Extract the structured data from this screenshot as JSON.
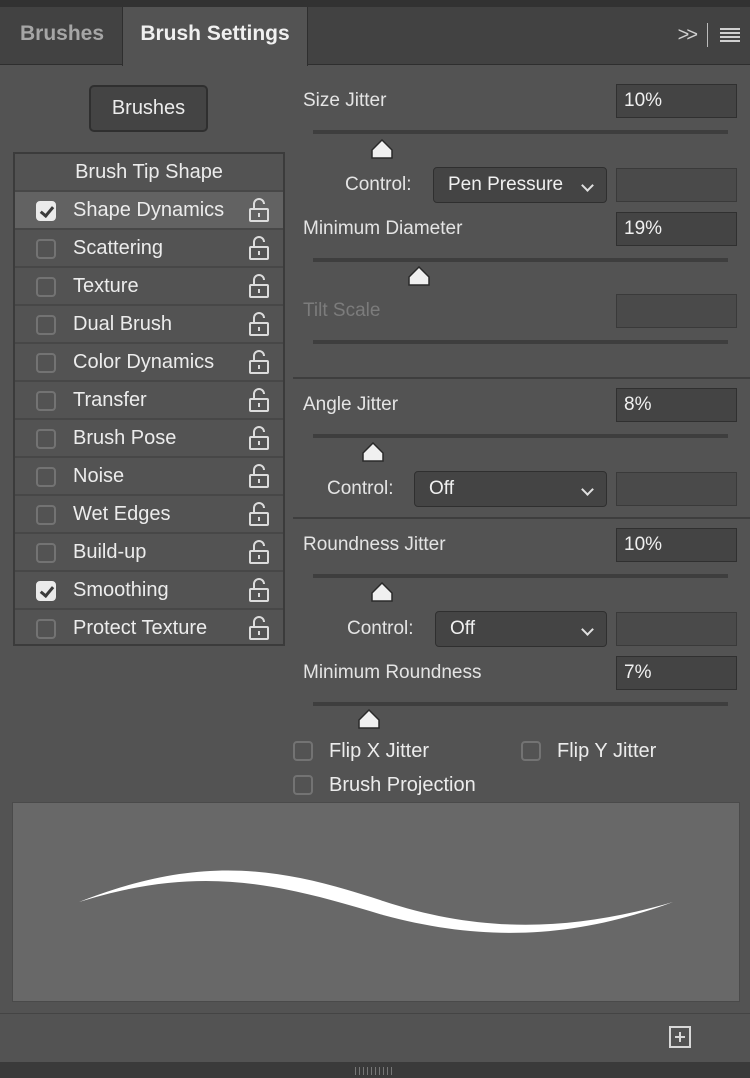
{
  "tabs": [
    {
      "label": "Brushes",
      "active": false
    },
    {
      "label": "Brush Settings",
      "active": true
    }
  ],
  "header_icons": [
    "expand-icon",
    "panel-menu-icon"
  ],
  "brushes_button": "Brushes",
  "brush_tip_shape": "Brush Tip Shape",
  "options": [
    {
      "label": "Shape Dynamics",
      "checked": true,
      "selected": true
    },
    {
      "label": "Scattering",
      "checked": false
    },
    {
      "label": "Texture",
      "checked": false
    },
    {
      "label": "Dual Brush",
      "checked": false
    },
    {
      "label": "Color Dynamics",
      "checked": false
    },
    {
      "label": "Transfer",
      "checked": false
    },
    {
      "label": "Brush Pose",
      "checked": false
    },
    {
      "label": "Noise",
      "checked": false
    },
    {
      "label": "Wet Edges",
      "checked": false
    },
    {
      "label": "Build-up",
      "checked": false
    },
    {
      "label": "Smoothing",
      "checked": true
    },
    {
      "label": "Protect Texture",
      "checked": false
    }
  ],
  "settings": {
    "size_jitter": {
      "label": "Size Jitter",
      "value": "10%",
      "level": 0.1
    },
    "size_control": {
      "label": "Control:",
      "value": "Pen Pressure"
    },
    "minimum_diameter": {
      "label": "Minimum Diameter",
      "value": "19%",
      "level": 0.19
    },
    "tilt_scale": {
      "label": "Tilt Scale",
      "value": "",
      "disabled": true
    },
    "angle_jitter": {
      "label": "Angle Jitter",
      "value": "8%",
      "level": 0.08
    },
    "angle_control": {
      "label": "Control:",
      "value": "Off"
    },
    "roundness_jitter": {
      "label": "Roundness Jitter",
      "value": "10%",
      "level": 0.1
    },
    "roundness_control": {
      "label": "Control:",
      "value": "Off"
    },
    "minimum_roundness": {
      "label": "Minimum Roundness",
      "value": "7%",
      "level": 0.07
    }
  },
  "flip_x": {
    "label": "Flip X Jitter",
    "checked": false
  },
  "flip_y": {
    "label": "Flip Y Jitter",
    "checked": false
  },
  "brush_projection": {
    "label": "Brush Projection",
    "checked": false
  },
  "colors": {
    "panel": "#535353",
    "tabbar": "#424242",
    "field": "#444444",
    "preview": "#686868",
    "stroke": "#ffffff"
  }
}
